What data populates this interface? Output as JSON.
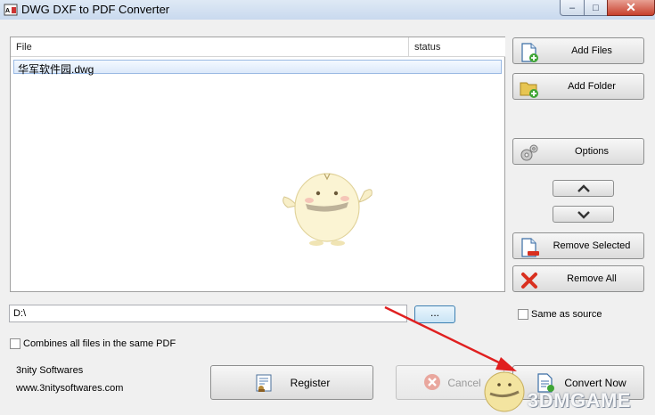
{
  "window": {
    "title": "DWG DXF to PDF Converter",
    "controls": {
      "minimize": "–",
      "maximize": "□",
      "close": "✕"
    },
    "icon": "app-icon"
  },
  "file_list": {
    "columns": [
      "File",
      "status"
    ],
    "rows": [
      {
        "file": "华军软件园.dwg",
        "status": ""
      }
    ]
  },
  "buttons": {
    "add_files": "Add Files",
    "add_folder": "Add Folder",
    "options": "Options",
    "move_up": "▲",
    "move_down": "▼",
    "remove_selected": "Remove Selected",
    "remove_all": "Remove All",
    "browse": "...",
    "register": "Register",
    "cancel": "Cancel",
    "convert_now": "Convert Now"
  },
  "output": {
    "path": "D:\\",
    "same_as_source_label": "Same as source",
    "same_as_source_checked": false
  },
  "combine": {
    "label": "Combines all files in the same PDF",
    "checked": false
  },
  "footer": {
    "company": "3nity Softwares",
    "website": "www.3nitysoftwares.com"
  },
  "watermark": {
    "text": "3DMGAME"
  },
  "colors": {
    "accent_blue": "#3c7fb1",
    "selection_border": "#9ab9e3",
    "remove_red": "#d9301f",
    "add_green": "#3fa535",
    "arrow_red": "#e02020"
  }
}
